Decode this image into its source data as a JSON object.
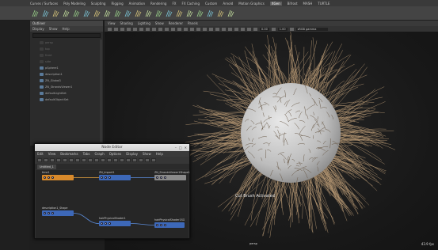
{
  "shelf": {
    "tabs": [
      "Curves / Surfaces",
      "Poly Modeling",
      "Sculpting",
      "Rigging",
      "Animation",
      "Rendering",
      "FX",
      "FX Caching",
      "Custom",
      "Arnold",
      "Motion Graphics",
      "XGen",
      "Bifrost",
      "MASH",
      "TURTLE"
    ],
    "active_tab_index": 11,
    "icons": [
      "xgen-create-icon",
      "xgen-description-icon",
      "xgen-guide-icon",
      "xgen-groom-icon",
      "xgen-brush-icon",
      "xgen-cut-icon",
      "xgen-comb-icon",
      "xgen-smooth-icon",
      "xgen-density-icon",
      "xgen-length-icon",
      "xgen-width-icon",
      "xgen-clump-icon",
      "xgen-noise-icon",
      "xgen-coil-icon",
      "xgen-collision-icon",
      "xgen-cache-icon",
      "xgen-export-icon",
      "xgen-render-icon",
      "xgen-settings-icon",
      "xgen-help-icon"
    ]
  },
  "outliner": {
    "title": "Outliner",
    "menu": [
      "Display",
      "Show",
      "Help"
    ],
    "items": [
      {
        "label": "persp",
        "dim": true
      },
      {
        "label": "top",
        "dim": true
      },
      {
        "label": "front",
        "dim": true
      },
      {
        "label": "side",
        "dim": true
      },
      {
        "label": "pSphere1",
        "dim": false
      },
      {
        "label": "description1",
        "dim": false
      },
      {
        "label": "ZN_Global1",
        "dim": false
      },
      {
        "label": "ZN_StrandsViewer1",
        "dim": false
      },
      {
        "label": "defaultLightSet",
        "dim": false
      },
      {
        "label": "defaultObjectSet",
        "dim": false
      }
    ]
  },
  "viewport": {
    "menu": [
      "View",
      "Shading",
      "Lighting",
      "Show",
      "Renderer",
      "Panels"
    ],
    "toolbar_field_1": "0.00",
    "toolbar_field_2": "1.00",
    "color_space": "sRGB gamma",
    "message": "Cut Brush Activated",
    "camera": "persp",
    "fps": "43.9 fps"
  },
  "node_editor": {
    "title": "Node Editor",
    "menu": [
      "Edit",
      "View",
      "Bookmarks",
      "Tabs",
      "Graph",
      "Options",
      "Display",
      "Show",
      "Help"
    ],
    "tab": "Untitled_1",
    "nodes": [
      {
        "label": "time1",
        "color": "#d98a2b"
      },
      {
        "label": "ZN_Import1",
        "color": "#3d68b8"
      },
      {
        "label": "ZN_StrandsViewer1Shape1",
        "color": "#8a8a8a"
      },
      {
        "label": "description1_Shape",
        "color": "#3d68b8"
      },
      {
        "label": "hairPhysicalShader1",
        "color": "#3d68b8"
      },
      {
        "label": "hairPhysicalShader1SG",
        "color": "#3d68b8"
      }
    ]
  },
  "colors": {
    "fur": "#c9a77e",
    "sphere": "#dcdcdc",
    "wire_orange": "#e0a040",
    "wire_blue": "#5b8ad6"
  }
}
